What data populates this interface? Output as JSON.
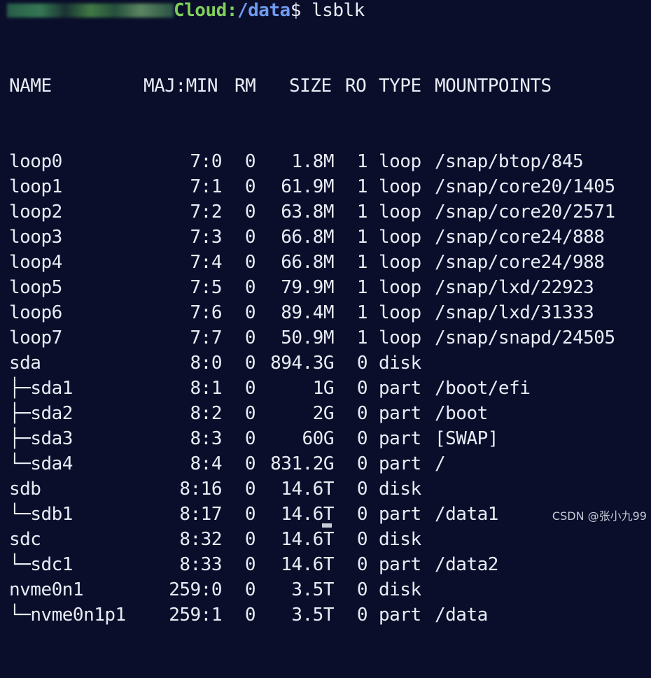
{
  "prompt": {
    "host_visible": "Cloud",
    "separator": ":",
    "path": "/data",
    "dollar": "$",
    "command": " lsblk"
  },
  "headers": {
    "name": "NAME",
    "majmin": "MAJ:MIN",
    "rm": "RM",
    "size": "SIZE",
    "ro": "RO",
    "type": "TYPE",
    "mountpoints": "MOUNTPOINTS"
  },
  "rows": [
    {
      "tree": "",
      "name": "loop0",
      "majmin": "7:0",
      "rm": "0",
      "size": "1.8M",
      "ro": "1",
      "type": "loop",
      "mount": "/snap/btop/845"
    },
    {
      "tree": "",
      "name": "loop1",
      "majmin": "7:1",
      "rm": "0",
      "size": "61.9M",
      "ro": "1",
      "type": "loop",
      "mount": "/snap/core20/1405"
    },
    {
      "tree": "",
      "name": "loop2",
      "majmin": "7:2",
      "rm": "0",
      "size": "63.8M",
      "ro": "1",
      "type": "loop",
      "mount": "/snap/core20/2571"
    },
    {
      "tree": "",
      "name": "loop3",
      "majmin": "7:3",
      "rm": "0",
      "size": "66.8M",
      "ro": "1",
      "type": "loop",
      "mount": "/snap/core24/888"
    },
    {
      "tree": "",
      "name": "loop4",
      "majmin": "7:4",
      "rm": "0",
      "size": "66.8M",
      "ro": "1",
      "type": "loop",
      "mount": "/snap/core24/988"
    },
    {
      "tree": "",
      "name": "loop5",
      "majmin": "7:5",
      "rm": "0",
      "size": "79.9M",
      "ro": "1",
      "type": "loop",
      "mount": "/snap/lxd/22923"
    },
    {
      "tree": "",
      "name": "loop6",
      "majmin": "7:6",
      "rm": "0",
      "size": "89.4M",
      "ro": "1",
      "type": "loop",
      "mount": "/snap/lxd/31333"
    },
    {
      "tree": "",
      "name": "loop7",
      "majmin": "7:7",
      "rm": "0",
      "size": "50.9M",
      "ro": "1",
      "type": "loop",
      "mount": "/snap/snapd/24505"
    },
    {
      "tree": "",
      "name": "sda",
      "majmin": "8:0",
      "rm": "0",
      "size": "894.3G",
      "ro": "0",
      "type": "disk",
      "mount": ""
    },
    {
      "tree": "├─",
      "name": "sda1",
      "majmin": "8:1",
      "rm": "0",
      "size": "1G",
      "ro": "0",
      "type": "part",
      "mount": "/boot/efi"
    },
    {
      "tree": "├─",
      "name": "sda2",
      "majmin": "8:2",
      "rm": "0",
      "size": "2G",
      "ro": "0",
      "type": "part",
      "mount": "/boot"
    },
    {
      "tree": "├─",
      "name": "sda3",
      "majmin": "8:3",
      "rm": "0",
      "size": "60G",
      "ro": "0",
      "type": "part",
      "mount": "[SWAP]"
    },
    {
      "tree": "└─",
      "name": "sda4",
      "majmin": "8:4",
      "rm": "0",
      "size": "831.2G",
      "ro": "0",
      "type": "part",
      "mount": "/"
    },
    {
      "tree": "",
      "name": "sdb",
      "majmin": "8:16",
      "rm": "0",
      "size": "14.6T",
      "ro": "0",
      "type": "disk",
      "mount": ""
    },
    {
      "tree": "└─",
      "name": "sdb1",
      "majmin": "8:17",
      "rm": "0",
      "size": "14.6T",
      "ro": "0",
      "type": "part",
      "mount": "/data1"
    },
    {
      "tree": "",
      "name": "sdc",
      "majmin": "8:32",
      "rm": "0",
      "size": "14.6T",
      "ro": "0",
      "type": "disk",
      "mount": ""
    },
    {
      "tree": "└─",
      "name": "sdc1",
      "majmin": "8:33",
      "rm": "0",
      "size": "14.6T",
      "ro": "0",
      "type": "part",
      "mount": "/data2"
    },
    {
      "tree": "",
      "name": "nvme0n1",
      "majmin": "259:0",
      "rm": "0",
      "size": "3.5T",
      "ro": "0",
      "type": "disk",
      "mount": ""
    },
    {
      "tree": "└─",
      "name": "nvme0n1p1",
      "majmin": "259:1",
      "rm": "0",
      "size": "3.5T",
      "ro": "0",
      "type": "part",
      "mount": "/data"
    }
  ],
  "watermark": "CSDN @张小九99",
  "colors": {
    "background": "#0a0e2a",
    "foreground": "#e8ecf5",
    "host": "#7fd05a",
    "path": "#6f9bf0"
  }
}
